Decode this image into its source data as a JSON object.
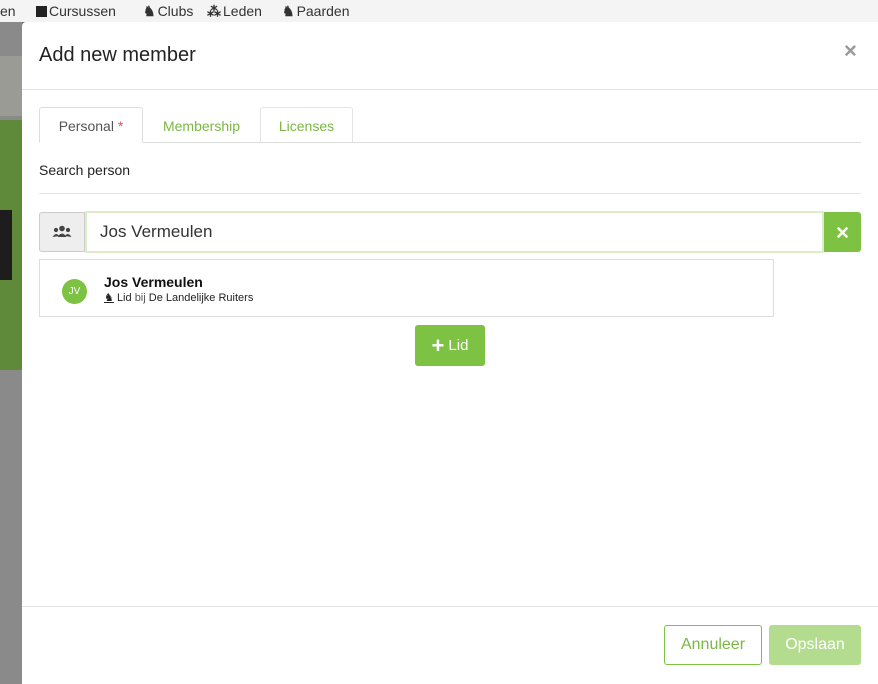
{
  "background_nav": {
    "items": [
      {
        "label": "en",
        "icon": ""
      },
      {
        "label": "Cursussen",
        "icon": "book-icon"
      },
      {
        "label": "Clubs",
        "icon": "horse-icon"
      },
      {
        "label": "Leden",
        "icon": "users-icon"
      },
      {
        "label": "Paarden",
        "icon": "horse-head-icon"
      }
    ]
  },
  "modal": {
    "title": "Add new member",
    "close_label": "×",
    "tabs": [
      {
        "label": "Personal",
        "required_mark": "*",
        "active": true
      },
      {
        "label": "Membership",
        "active": false
      },
      {
        "label": "Licenses",
        "active": false
      }
    ],
    "section_label": "Search person",
    "search": {
      "value": "Jos Vermeulen",
      "placeholder": "",
      "addon_icon": "users-icon",
      "clear_icon": "close-icon"
    },
    "result": {
      "initials": "JV",
      "name": "Jos Vermeulen",
      "role": "Lid",
      "connector": "bij",
      "club": "De Landelijke Ruiters",
      "role_icon": "horse-icon"
    },
    "add_button_label": "Lid",
    "footer": {
      "cancel_label": "Annuleer",
      "save_label": "Opslaan"
    }
  },
  "colors": {
    "accent": "#7dc242",
    "accent_text": "#7ab843",
    "save_disabled": "#b4dc8f",
    "required": "#d9534f"
  }
}
